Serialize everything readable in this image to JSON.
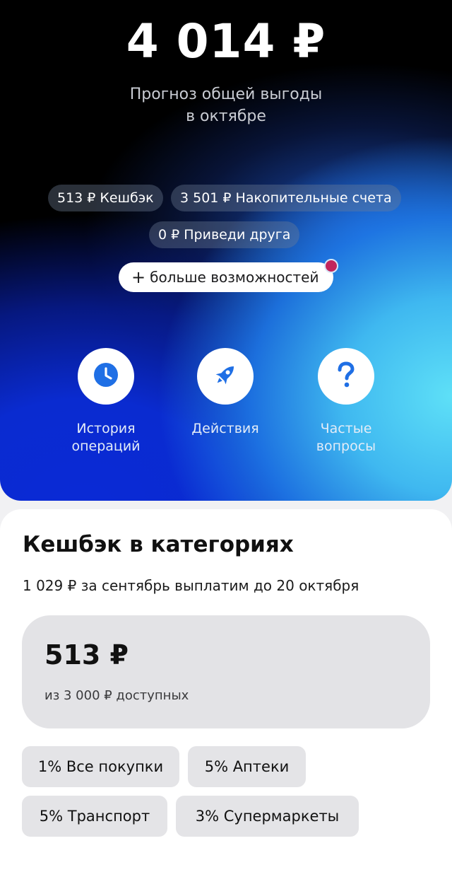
{
  "hero": {
    "total": "4 014 ₽",
    "subtitle_line1": "Прогноз общей выгоды",
    "subtitle_line2": "в октябре",
    "chips": [
      {
        "label": "513 ₽ Кешбэк"
      },
      {
        "label": "3 501 ₽ Накопительные счета"
      },
      {
        "label": "0 ₽ Приведи друга"
      }
    ],
    "more_button": {
      "icon": "plus-icon",
      "label": "больше возможностей",
      "has_notification": true
    }
  },
  "actions": [
    {
      "icon": "clock-icon",
      "line1": "История",
      "line2": "операций"
    },
    {
      "icon": "rocket-icon",
      "line1": "Действия",
      "line2": ""
    },
    {
      "icon": "question-icon",
      "line1": "Частые",
      "line2": "вопросы"
    }
  ],
  "cashback": {
    "title": "Кешбэк в категориях",
    "subtitle": "1 029 ₽ за сентябрь выплатим до 20 октября",
    "amount": "513 ₽",
    "available": "из 3 000 ₽ доступных",
    "categories": [
      {
        "label": "1% Все покупки"
      },
      {
        "label": "5% Аптеки"
      },
      {
        "label": "5% Транспорт"
      },
      {
        "label": "3% Супермаркеты"
      }
    ]
  },
  "colors": {
    "accent_blue": "#1f6fe5",
    "notification": "#c2255c",
    "chip_bg": "#6e7d96"
  }
}
